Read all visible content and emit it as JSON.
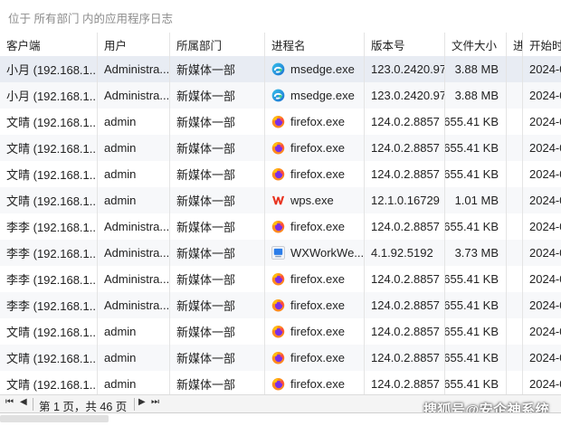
{
  "search": {
    "placeholder": "位于 所有部门 内的应用程序日志"
  },
  "table": {
    "columns": [
      "客户端",
      "用户",
      "所属部门",
      "进程名",
      "版本号",
      "文件大小",
      "进",
      "开始时"
    ],
    "rows": [
      {
        "client": "小月 (192.168.1...",
        "user": "Administra...",
        "dept": "新媒体一部",
        "icon": "edge-icon",
        "proc": "msedge.exe",
        "version": "123.0.2420.97",
        "size": "3.88 MB",
        "start": "2024-0"
      },
      {
        "client": "小月 (192.168.1...",
        "user": "Administra...",
        "dept": "新媒体一部",
        "icon": "edge-icon",
        "proc": "msedge.exe",
        "version": "123.0.2420.97",
        "size": "3.88 MB",
        "start": "2024-0"
      },
      {
        "client": "文晴 (192.168.1...",
        "user": "admin",
        "dept": "新媒体一部",
        "icon": "firefox-icon",
        "proc": "firefox.exe",
        "version": "124.0.2.8857",
        "size": "655.41 KB",
        "start": "2024-0"
      },
      {
        "client": "文晴 (192.168.1...",
        "user": "admin",
        "dept": "新媒体一部",
        "icon": "firefox-icon",
        "proc": "firefox.exe",
        "version": "124.0.2.8857",
        "size": "655.41 KB",
        "start": "2024-0"
      },
      {
        "client": "文晴 (192.168.1...",
        "user": "admin",
        "dept": "新媒体一部",
        "icon": "firefox-icon",
        "proc": "firefox.exe",
        "version": "124.0.2.8857",
        "size": "655.41 KB",
        "start": "2024-0"
      },
      {
        "client": "文晴 (192.168.1...",
        "user": "admin",
        "dept": "新媒体一部",
        "icon": "wps-icon",
        "proc": "wps.exe",
        "version": "12.1.0.16729",
        "size": "1.01 MB",
        "start": "2024-0"
      },
      {
        "client": "李李 (192.168.1...",
        "user": "Administra...",
        "dept": "新媒体一部",
        "icon": "firefox-icon",
        "proc": "firefox.exe",
        "version": "124.0.2.8857",
        "size": "655.41 KB",
        "start": "2024-0"
      },
      {
        "client": "李李 (192.168.1...",
        "user": "Administra...",
        "dept": "新媒体一部",
        "icon": "wxwork-icon",
        "proc": "WXWorkWe...",
        "version": "4.1.92.5192",
        "size": "3.73 MB",
        "start": "2024-0"
      },
      {
        "client": "李李 (192.168.1...",
        "user": "Administra...",
        "dept": "新媒体一部",
        "icon": "firefox-icon",
        "proc": "firefox.exe",
        "version": "124.0.2.8857",
        "size": "655.41 KB",
        "start": "2024-0"
      },
      {
        "client": "李李 (192.168.1...",
        "user": "Administra...",
        "dept": "新媒体一部",
        "icon": "firefox-icon",
        "proc": "firefox.exe",
        "version": "124.0.2.8857",
        "size": "655.41 KB",
        "start": "2024-0"
      },
      {
        "client": "文晴 (192.168.1...",
        "user": "admin",
        "dept": "新媒体一部",
        "icon": "firefox-icon",
        "proc": "firefox.exe",
        "version": "124.0.2.8857",
        "size": "655.41 KB",
        "start": "2024-0"
      },
      {
        "client": "文晴 (192.168.1...",
        "user": "admin",
        "dept": "新媒体一部",
        "icon": "firefox-icon",
        "proc": "firefox.exe",
        "version": "124.0.2.8857",
        "size": "655.41 KB",
        "start": "2024-0"
      },
      {
        "client": "文晴 (192.168.1...",
        "user": "admin",
        "dept": "新媒体一部",
        "icon": "firefox-icon",
        "proc": "firefox.exe",
        "version": "124.0.2.8857",
        "size": "655.41 KB",
        "start": "2024-0"
      }
    ]
  },
  "pager": {
    "text": "第 1 页，共 46 页"
  },
  "watermark": "搜狐号@安企神系统",
  "colors": {
    "selected_row": "#e8ecf3",
    "grid_line": "#e4e4e4"
  }
}
